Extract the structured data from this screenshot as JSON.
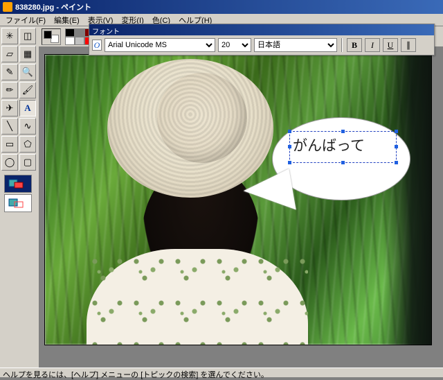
{
  "window": {
    "title": "838280.jpg - ペイント"
  },
  "menu": {
    "file": "ファイル(F)",
    "edit": "編集(E)",
    "view": "表示(V)",
    "image": "変形(I)",
    "colors": "色(C)",
    "help": "ヘルプ(H)"
  },
  "font_toolbar": {
    "title": "フォント",
    "font": "Arial Unicode MS",
    "size": "20",
    "charset": "日本語",
    "bold": "B",
    "italic": "I",
    "underline": "U"
  },
  "tools": [
    {
      "name": "free-select",
      "glyph": "✳"
    },
    {
      "name": "rect-select",
      "glyph": "◫"
    },
    {
      "name": "eraser",
      "glyph": "▱"
    },
    {
      "name": "fill",
      "glyph": "▦"
    },
    {
      "name": "eyedropper",
      "glyph": "✎"
    },
    {
      "name": "magnifier",
      "glyph": "🔍"
    },
    {
      "name": "pencil",
      "glyph": "✏"
    },
    {
      "name": "brush",
      "glyph": "🖌"
    },
    {
      "name": "airbrush",
      "glyph": "✈"
    },
    {
      "name": "text",
      "glyph": "A",
      "active": true
    },
    {
      "name": "line",
      "glyph": "╲"
    },
    {
      "name": "curve",
      "glyph": "∿"
    },
    {
      "name": "rectangle",
      "glyph": "▭"
    },
    {
      "name": "polygon",
      "glyph": "⬠"
    },
    {
      "name": "ellipse",
      "glyph": "◯"
    },
    {
      "name": "rounded-rect",
      "glyph": "▢"
    }
  ],
  "palette_top": [
    "#000000",
    "#808080",
    "#800000",
    "#808000",
    "#008000",
    "#008080",
    "#000080",
    "#800080",
    "#808040",
    "#004040",
    "#0080ff",
    "#004080",
    "#4000ff",
    "#804000"
  ],
  "palette_bot": [
    "#ffffff",
    "#c0c0c0",
    "#ff0000",
    "#ffff00",
    "#00ff00",
    "#00ffff",
    "#0000ff",
    "#ff00ff",
    "#ffff80",
    "#00ff80",
    "#80ffff",
    "#8080ff",
    "#ff0080",
    "#ff8040"
  ],
  "text_edit": {
    "content": "がんばって"
  },
  "status": "ヘルプを見るには、[ヘルプ] メニューの [トピックの検索] を選んでください。"
}
